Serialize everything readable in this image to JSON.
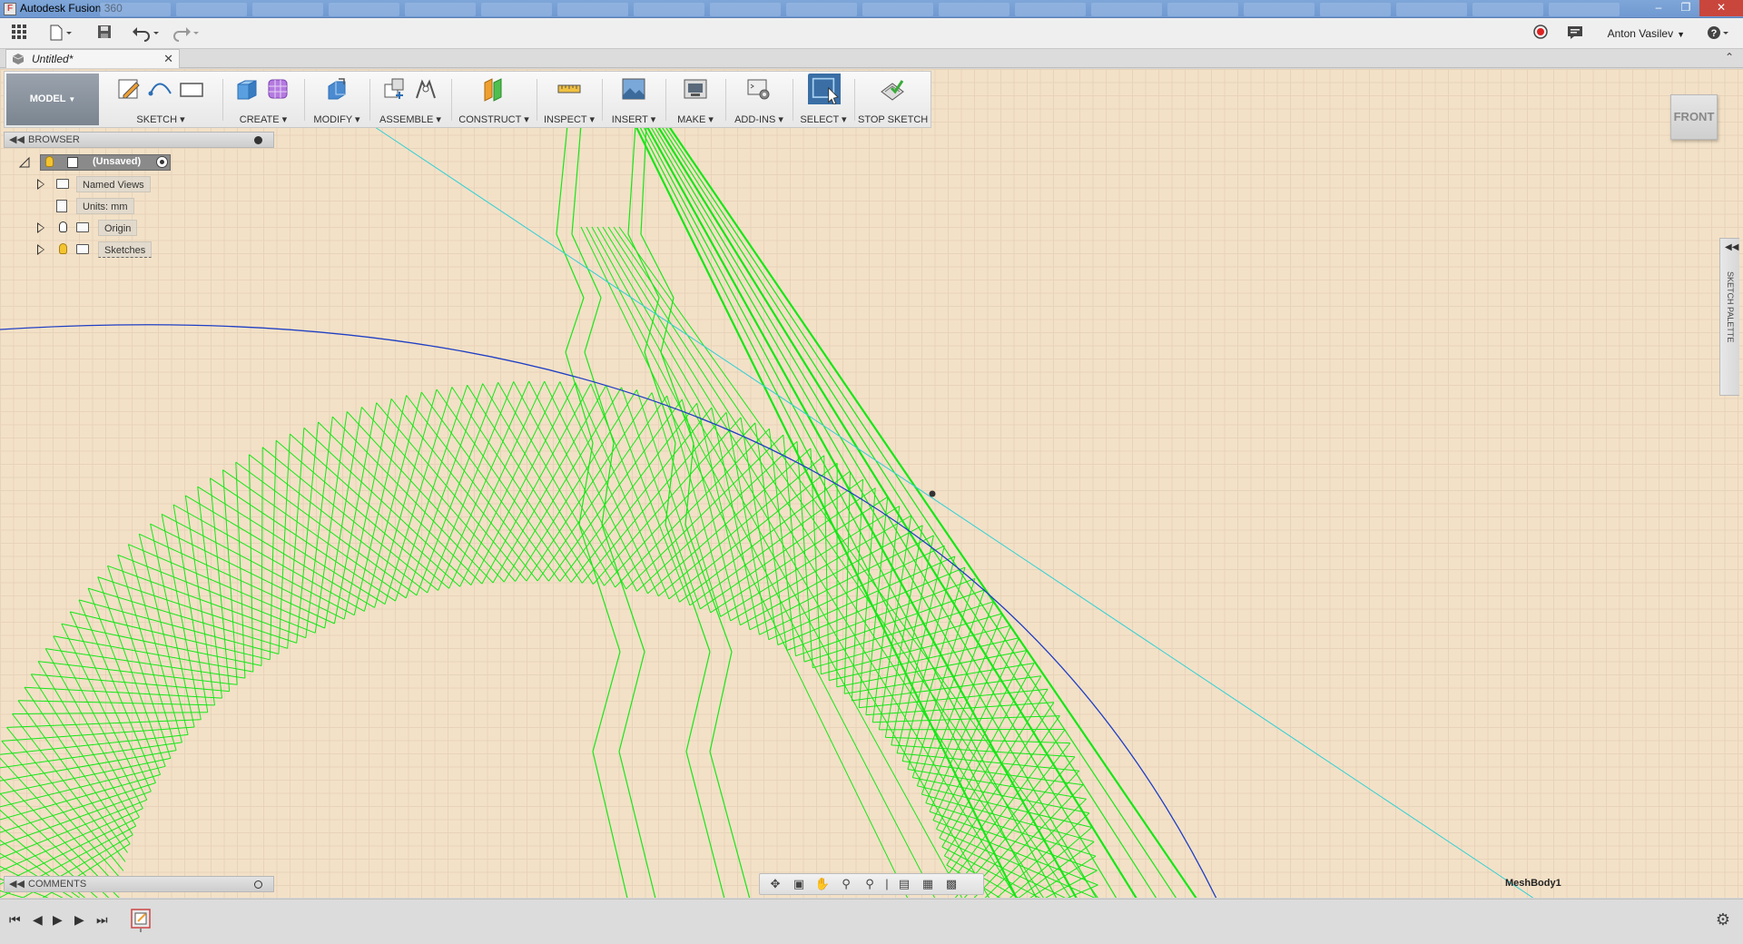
{
  "window": {
    "title": "Autodesk Fusion 360"
  },
  "quick_access": {
    "user_name": "Anton Vasilev"
  },
  "document": {
    "tab_title": "Untitled*"
  },
  "ribbon": {
    "workspace": "MODEL",
    "groups": {
      "sketch": "SKETCH",
      "create": "CREATE",
      "modify": "MODIFY",
      "assemble": "ASSEMBLE",
      "construct": "CONSTRUCT",
      "inspect": "INSPECT",
      "insert": "INSERT",
      "make": "MAKE",
      "addins": "ADD-INS",
      "select": "SELECT",
      "stop_sketch": "STOP SKETCH"
    }
  },
  "viewcube": {
    "face": "FRONT"
  },
  "browser": {
    "title": "BROWSER",
    "root": "(Unsaved)",
    "items": [
      {
        "label": "Named Views"
      },
      {
        "label": "Units: mm"
      },
      {
        "label": "Origin"
      },
      {
        "label": "Sketches"
      }
    ]
  },
  "comments": {
    "title": "COMMENTS"
  },
  "sketch_palette": {
    "label": "SKETCH PALETTE"
  },
  "canvas": {
    "body_label": "MeshBody1"
  },
  "colors": {
    "canvas_bg": "#f3e1c7",
    "sketch_green": "#17e617",
    "arc_blue": "#1f3fc4",
    "construction_cyan": "#2fd0d6",
    "select_active": "#3a6ea5"
  }
}
